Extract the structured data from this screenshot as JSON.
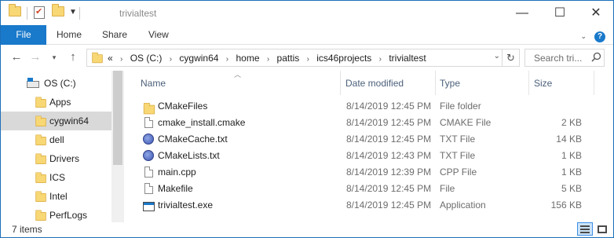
{
  "window": {
    "title": "trivialtest",
    "minimize_icon": "minimize-icon",
    "maximize_icon": "maximize-icon",
    "close_icon": "close-icon"
  },
  "ribbon": {
    "tabs": [
      "File",
      "Home",
      "Share",
      "View"
    ],
    "accent": "#1979ca"
  },
  "address": {
    "overflow": "«",
    "crumbs": [
      "OS (C:)",
      "cygwin64",
      "home",
      "pattis",
      "ics46projects",
      "trivialtest"
    ],
    "search_placeholder": "Search tri..."
  },
  "nav_pane": {
    "items": [
      {
        "label": "OS (C:)",
        "icon": "drive-icon"
      },
      {
        "label": "Apps",
        "icon": "folder-icon"
      },
      {
        "label": "cygwin64",
        "icon": "folder-icon",
        "selected": true
      },
      {
        "label": "dell",
        "icon": "folder-icon"
      },
      {
        "label": "Drivers",
        "icon": "folder-icon"
      },
      {
        "label": "ICS",
        "icon": "folder-icon"
      },
      {
        "label": "Intel",
        "icon": "folder-icon"
      },
      {
        "label": "PerfLogs",
        "icon": "folder-icon"
      }
    ]
  },
  "columns": {
    "name": "Name",
    "date": "Date modified",
    "type": "Type",
    "size": "Size"
  },
  "files": [
    {
      "name": "CMakeFiles",
      "date": "8/14/2019 12:45 PM",
      "type": "File folder",
      "size": "",
      "icon": "folder-icon"
    },
    {
      "name": "cmake_install.cmake",
      "date": "8/14/2019 12:45 PM",
      "type": "CMAKE File",
      "size": "2 KB",
      "icon": "document-icon"
    },
    {
      "name": "CMakeCache.txt",
      "date": "8/14/2019 12:45 PM",
      "type": "TXT File",
      "size": "14 KB",
      "icon": "text-file-icon"
    },
    {
      "name": "CMakeLists.txt",
      "date": "8/14/2019 12:43 PM",
      "type": "TXT File",
      "size": "1 KB",
      "icon": "text-file-icon"
    },
    {
      "name": "main.cpp",
      "date": "8/14/2019 12:39 PM",
      "type": "CPP File",
      "size": "1 KB",
      "icon": "document-icon"
    },
    {
      "name": "Makefile",
      "date": "8/14/2019 12:45 PM",
      "type": "File",
      "size": "5 KB",
      "icon": "document-icon"
    },
    {
      "name": "trivialtest.exe",
      "date": "8/14/2019 12:45 PM",
      "type": "Application",
      "size": "156 KB",
      "icon": "application-icon"
    }
  ],
  "status": {
    "item_count": "7 items"
  }
}
